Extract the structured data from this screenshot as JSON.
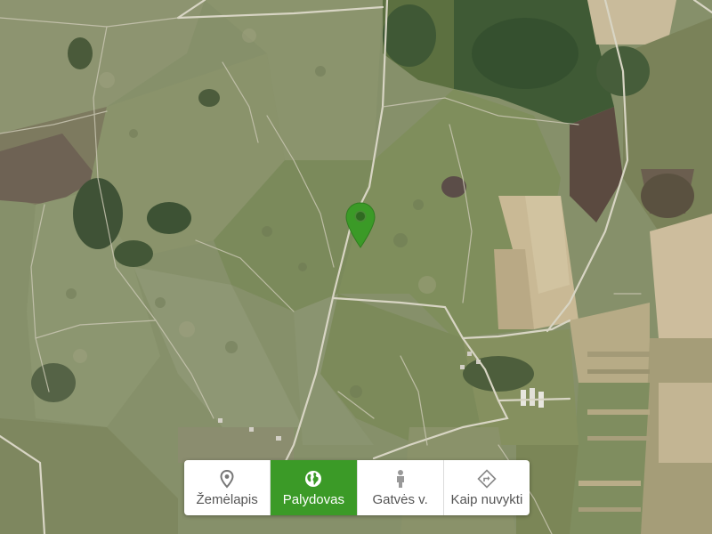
{
  "map": {
    "type": "satellite",
    "marker_color": "#3b9a27"
  },
  "view_switcher": {
    "active_tab": "Palydovas",
    "accent_color": "#3b9a27",
    "tabs": [
      {
        "label": "Žemėlapis",
        "icon": "map-pin-icon"
      },
      {
        "label": "Palydovas",
        "icon": "globe-icon"
      },
      {
        "label": "Gatvės v.",
        "icon": "street-view-person-icon"
      },
      {
        "label": "Kaip nuvykti",
        "icon": "directions-icon"
      }
    ]
  }
}
